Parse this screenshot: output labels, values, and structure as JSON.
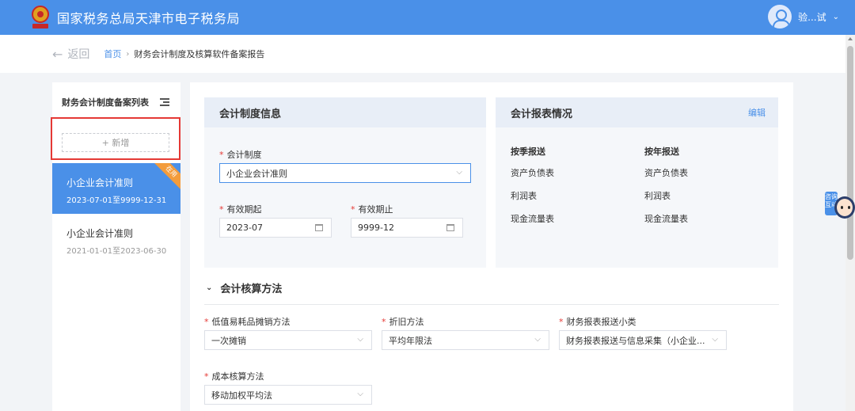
{
  "header": {
    "site_title": "国家税务总局天津市电子税务局",
    "user_name": "验...试",
    "user_chevron": "⌄"
  },
  "breadcrumb": {
    "back_label": "返回",
    "home": "首页",
    "separator": "›",
    "current": "财务会计制度及核算软件备案报告"
  },
  "sidebar": {
    "title": "财务会计制度备案列表",
    "add_label": "+ 新增",
    "items": [
      {
        "name": "小企业会计准则",
        "range": "2023-07-01至9999-12-31",
        "badge": "在用",
        "active": true
      },
      {
        "name": "小企业会计准则",
        "range": "2021-01-01至2023-06-30",
        "active": false
      }
    ]
  },
  "accounting_system_card": {
    "title": "会计制度信息",
    "system_label": "会计制度",
    "system_value": "小企业会计准则",
    "start_label": "有效期起",
    "start_value": "2023-07",
    "end_label": "有效期止",
    "end_value": "9999-12"
  },
  "reports_card": {
    "title": "会计报表情况",
    "edit_label": "编辑",
    "quarterly": {
      "header": "按季报送",
      "items": [
        "资产负债表",
        "利润表",
        "现金流量表"
      ]
    },
    "annual": {
      "header": "按年报送",
      "items": [
        "资产负债表",
        "利润表",
        "现金流量表"
      ]
    }
  },
  "methods": {
    "section_title": "会计核算方法",
    "section_chevron": "⌄",
    "low_value_label": "低值易耗品摊销方法",
    "low_value_value": "一次摊销",
    "depreciation_label": "折旧方法",
    "depreciation_value": "平均年限法",
    "report_subtype_label": "财务报表报送小类",
    "report_subtype_value": "财务报表报送与信息采集（小企业...",
    "cost_label": "成本核算方法",
    "cost_value": "移动加权平均法"
  },
  "icons": {
    "required_mark": "*",
    "dropdown": "⌵"
  },
  "helper": {
    "label": "咨询互动"
  },
  "colors": {
    "primary": "#4a90e8",
    "highlight_border": "#e53935",
    "badge": "#f39c3c"
  }
}
